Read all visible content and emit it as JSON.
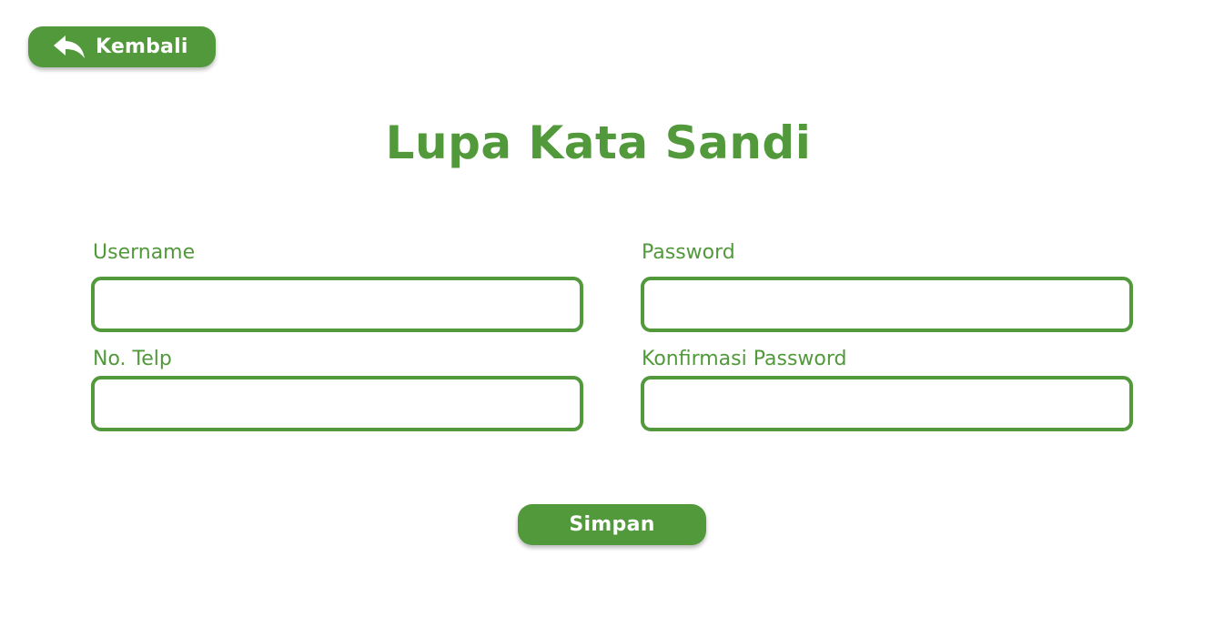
{
  "colors": {
    "accent": "#52993b",
    "background": "#ffffff",
    "button_text": "#ffffff"
  },
  "header": {
    "back_label": "Kembali",
    "back_icon": "reply-arrow-icon"
  },
  "page_title": "Lupa Kata Sandi",
  "form": {
    "username": {
      "label": "Username",
      "value": "",
      "placeholder": ""
    },
    "password": {
      "label": "Password",
      "value": "",
      "placeholder": ""
    },
    "phone": {
      "label": "No. Telp",
      "value": "",
      "placeholder": ""
    },
    "confirm_password": {
      "label": "Konfirmasi Password",
      "value": "",
      "placeholder": ""
    }
  },
  "actions": {
    "save_label": "Simpan"
  }
}
